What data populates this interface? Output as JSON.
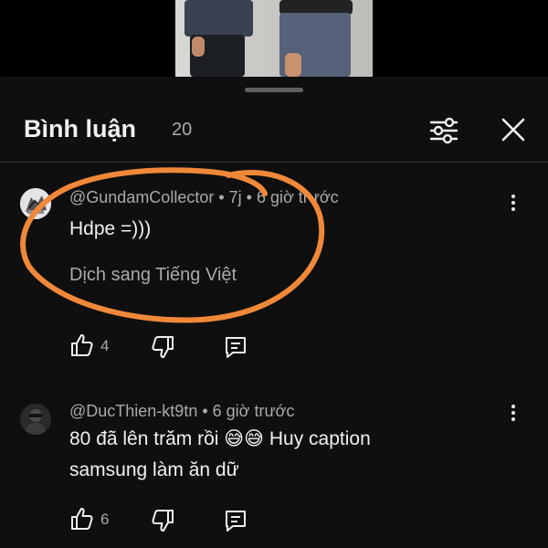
{
  "header": {
    "title": "Bình luận",
    "count": "20"
  },
  "comments": [
    {
      "author": "@GundamCollector",
      "edited": "7j",
      "time": "6 giờ trước",
      "text": "Hdpe =)))",
      "translate": "Dịch sang Tiếng Việt",
      "likes": "4"
    },
    {
      "author": "@DucThien-kt9tn",
      "time": "6 giờ trước",
      "text_lines": [
        "80 đã lên trăm rồi 😅😅 Huy caption",
        "samsung làm ăn dữ"
      ],
      "likes": "6"
    }
  ],
  "icons": [
    "filter-icon",
    "close-icon",
    "more-vert-icon",
    "like-icon",
    "dislike-icon",
    "reply-icon"
  ],
  "colors": {
    "background": "#0f0f0f",
    "text": "#f1f1f1",
    "secondary": "#aaaaaa",
    "annotation": "#f0883a"
  }
}
